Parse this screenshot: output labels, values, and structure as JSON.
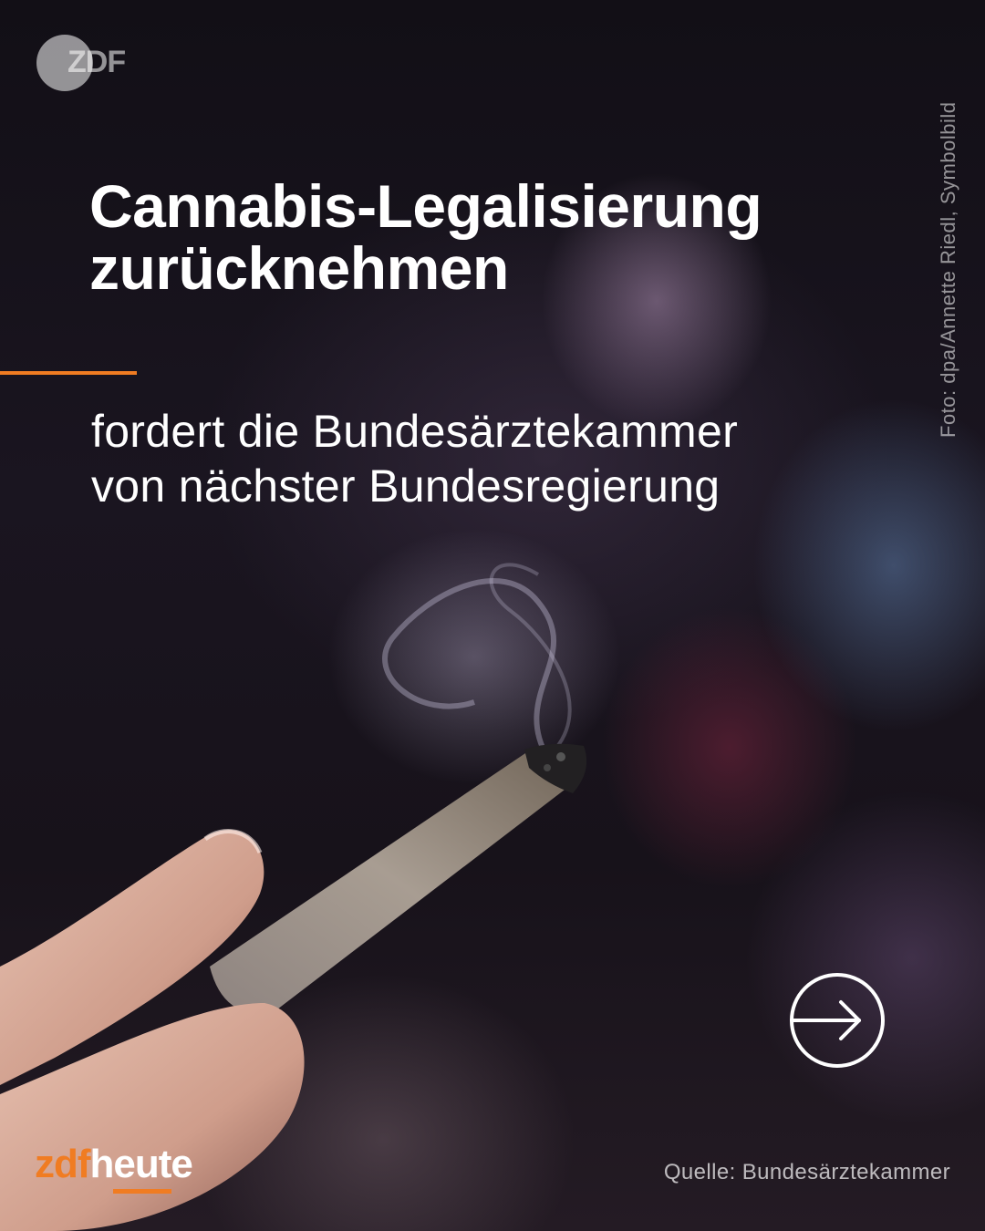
{
  "logo": {
    "text": "ZDF"
  },
  "photo_credit": "Foto: dpa/Annette Riedl, Symbolbild",
  "headline": {
    "line1": "Cannabis-Legalisierung",
    "line2": "zurücknehmen"
  },
  "subline": {
    "line1": "fordert die Bundesärztekammer",
    "line2": "von nächster Bundesregierung"
  },
  "next_button": {
    "icon": "arrow-right-circle-icon"
  },
  "brand": {
    "part1": "zdf",
    "part2": "heute"
  },
  "source": "Quelle: Bundesärztekammer",
  "colors": {
    "accent": "#f07c22",
    "text": "#ffffff",
    "background": "#120f16"
  }
}
